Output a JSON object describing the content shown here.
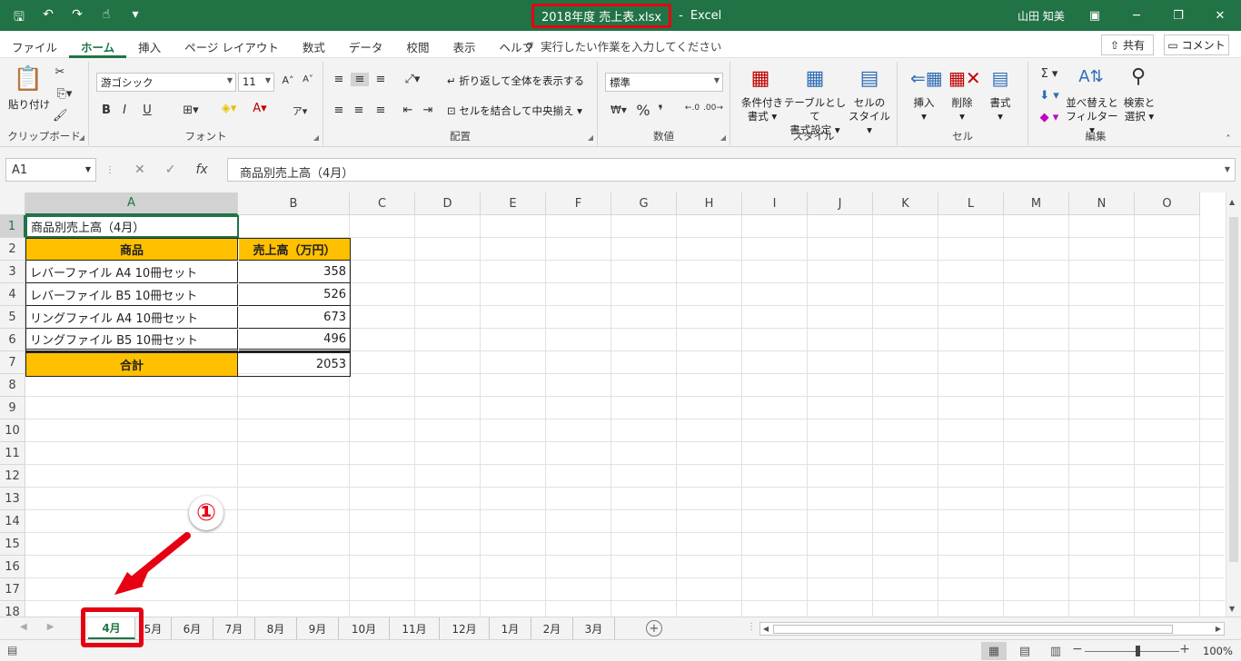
{
  "titlebar": {
    "filename": "2018年度 売上表.xlsx",
    "separator": "-",
    "app": "Excel",
    "user": "山田 知美"
  },
  "menu": {
    "tabs": [
      "ファイル",
      "ホーム",
      "挿入",
      "ページ レイアウト",
      "数式",
      "データ",
      "校閲",
      "表示",
      "ヘルプ"
    ],
    "active_tab": "ホーム",
    "tell_me": "実行したい作業を入力してください",
    "share": "共有",
    "comment": "コメント"
  },
  "ribbon": {
    "clipboard": {
      "paste": "貼り付け",
      "name": "クリップボード"
    },
    "font": {
      "family": "游ゴシック",
      "size": "11",
      "bold": "B",
      "italic": "I",
      "underline": "U",
      "name": "フォント"
    },
    "alignment": {
      "wrap": "折り返して全体を表示する",
      "merge": "セルを結合して中央揃え",
      "name": "配置"
    },
    "number": {
      "format": "標準",
      "percent": "%",
      "comma": "❜",
      "name": "数値"
    },
    "styles": {
      "conditional": [
        "条件付き",
        "書式"
      ],
      "table": [
        "テーブルとして",
        "書式設定"
      ],
      "cell": [
        "セルの",
        "スタイル"
      ],
      "name": "スタイル"
    },
    "cells": {
      "insert": "挿入",
      "delete": "削除",
      "format": "書式",
      "name": "セル"
    },
    "editing": {
      "sort": [
        "並べ替えと",
        "フィルター"
      ],
      "find": [
        "検索と",
        "選択"
      ],
      "name": "編集"
    }
  },
  "formula_bar": {
    "name_box": "A1",
    "fx": "fx",
    "content": "商品別売上高（4月）"
  },
  "columns": [
    "A",
    "B",
    "C",
    "D",
    "E",
    "F",
    "G",
    "H",
    "I",
    "J",
    "K",
    "L",
    "M",
    "N",
    "O"
  ],
  "rows": [
    "1",
    "2",
    "3",
    "4",
    "5",
    "6",
    "7",
    "8",
    "9",
    "10",
    "11",
    "12",
    "13",
    "14",
    "15",
    "16",
    "17",
    "18"
  ],
  "sheet": {
    "title": "商品別売上高（4月）",
    "header_product": "商品",
    "header_sales": "売上高（万円）",
    "items": [
      {
        "name": "レバーファイル A4 10冊セット",
        "value": "358"
      },
      {
        "name": "レバーファイル B5 10冊セット",
        "value": "526"
      },
      {
        "name": "リングファイル A4 10冊セット",
        "value": "673"
      },
      {
        "name": "リングファイル B5 10冊セット",
        "value": "496"
      }
    ],
    "total_label": "合計",
    "total_value": "2053"
  },
  "sheet_tabs": [
    "4月",
    "5月",
    "6月",
    "7月",
    "8月",
    "9月",
    "10月",
    "11月",
    "12月",
    "1月",
    "2月",
    "3月"
  ],
  "active_sheet": "4月",
  "annotation": {
    "step": "①"
  },
  "status": {
    "zoom": "100%"
  },
  "colors": {
    "excel_green": "#217346",
    "header_fill": "#ffc000",
    "highlight_red": "#e60012"
  }
}
